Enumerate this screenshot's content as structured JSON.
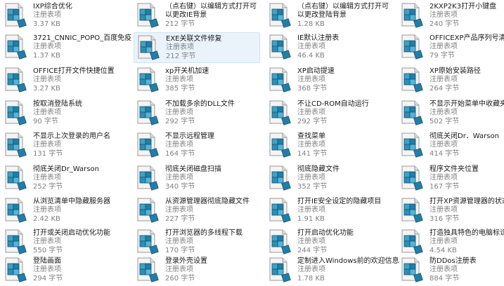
{
  "files": [
    {
      "name": "IXP综合优化",
      "type": "注册表项",
      "size": "3.37 KB",
      "two_line": false,
      "selected": false
    },
    {
      "name": "（点右键）以编辑方式打开可以更改IE背景",
      "type": "注册表项",
      "size": "212 字节",
      "two_line": true,
      "selected": false
    },
    {
      "name": "（点右键）以编辑方式打开可以更改登陆背景",
      "type": "注册表项",
      "size": "1.28 KB",
      "two_line": true,
      "selected": false
    },
    {
      "name": "2KXP2K3打开小键盘",
      "type": "注册表项",
      "size": "240 字节",
      "two_line": false,
      "selected": false
    },
    {
      "name": "3721_CNNIC_POPO_百度免疫",
      "type": "注册表项",
      "size": "1.37 KB",
      "two_line": false,
      "selected": false
    },
    {
      "name": "EXE关联文件修复",
      "type": "注册表项",
      "size": "212 字节",
      "two_line": false,
      "selected": true
    },
    {
      "name": "IE默认注册表",
      "type": "注册表项",
      "size": "46.4 KB",
      "two_line": false,
      "selected": false
    },
    {
      "name": "OFFICEXP产品序列号清除",
      "type": "注册表项",
      "size": "79 字节",
      "two_line": false,
      "selected": false
    },
    {
      "name": "OFFICE打开文件快捷位置",
      "type": "注册表项",
      "size": "3.27 KB",
      "two_line": false,
      "selected": false
    },
    {
      "name": "xp开关机加速",
      "type": "注册表项",
      "size": "385 字节",
      "two_line": false,
      "selected": false
    },
    {
      "name": "XP启动提速",
      "type": "注册表项",
      "size": "368 字节",
      "two_line": false,
      "selected": false
    },
    {
      "name": "XP原始安装路径",
      "type": "注册表项",
      "size": "264 字节",
      "two_line": false,
      "selected": false
    },
    {
      "name": "按取消登陆系统",
      "type": "注册表项",
      "size": "90 字节",
      "two_line": false,
      "selected": false
    },
    {
      "name": "不加载多余的DLL文件",
      "type": "注册表项",
      "size": "292 字节",
      "two_line": false,
      "selected": false
    },
    {
      "name": "不让CD-ROM自动运行",
      "type": "注册表项",
      "size": "292 字节",
      "two_line": false,
      "selected": false
    },
    {
      "name": "不显示开始菜单中收藏夹菜单",
      "type": "注册表项",
      "size": "502 字节",
      "two_line": false,
      "selected": false
    },
    {
      "name": "不显示上次登录的用户名",
      "type": "注册表项",
      "size": "131 字节",
      "two_line": false,
      "selected": false
    },
    {
      "name": "不显示远程管理",
      "type": "注册表项",
      "size": "164 字节",
      "two_line": false,
      "selected": false
    },
    {
      "name": "查找菜单",
      "type": "注册表项",
      "size": "141 字节",
      "two_line": false,
      "selected": false
    },
    {
      "name": "彻底关闭Dr．Warson",
      "type": "注册表项",
      "size": "414 字节",
      "two_line": false,
      "selected": false
    },
    {
      "name": "彻底关闭Dr_Warson",
      "type": "注册表项",
      "size": "252 字节",
      "two_line": false,
      "selected": false
    },
    {
      "name": "彻底关闭磁盘扫描",
      "type": "注册表项",
      "size": "340 字节",
      "two_line": false,
      "selected": false
    },
    {
      "name": "彻底隐藏文件",
      "type": "注册表项",
      "size": "352 字节",
      "two_line": false,
      "selected": false
    },
    {
      "name": "程序文件夹位置",
      "type": "注册表项",
      "size": "167 字节",
      "two_line": false,
      "selected": false
    },
    {
      "name": "从浏览清单中隐藏服务器",
      "type": "注册表项",
      "size": "2.42 KB",
      "two_line": false,
      "selected": false
    },
    {
      "name": "从资源管理器彻底隐藏文件",
      "type": "注册表项",
      "size": "227 字节",
      "two_line": false,
      "selected": false
    },
    {
      "name": "打开IE安全设定的隐藏项目",
      "type": "注册表项",
      "size": "1.91 KB",
      "two_line": false,
      "selected": false
    },
    {
      "name": "打开XP资源管理器的状态栏",
      "type": "注册表项",
      "size": "316 字节",
      "two_line": false,
      "selected": false
    },
    {
      "name": "打开或关闭启动优化功能",
      "type": "注册表项",
      "size": "550 字节",
      "two_line": false,
      "selected": false
    },
    {
      "name": "打开浏览器的多线程下载",
      "type": "注册表项",
      "size": "170 字节",
      "two_line": false,
      "selected": false
    },
    {
      "name": "打开启动优化功能",
      "type": "注册表项",
      "size": "244 字节",
      "two_line": false,
      "selected": false
    },
    {
      "name": "打造独具特色的电脑标识",
      "type": "注册表项",
      "size": "4.54 KB",
      "two_line": false,
      "selected": false
    },
    {
      "name": "登陆画面",
      "type": "注册表项",
      "size": "294 字节",
      "two_line": false,
      "selected": false
    },
    {
      "name": "登录外壳设置",
      "type": "注册表项",
      "size": "260 字节",
      "two_line": false,
      "selected": false
    },
    {
      "name": "定制进入Windows前的欢迎信息",
      "type": "注册表项",
      "size": "1.78 KB",
      "two_line": false,
      "selected": false
    },
    {
      "name": "防DDos注册表",
      "type": "注册表项",
      "size": "884 字节",
      "two_line": false,
      "selected": false
    }
  ],
  "icon": "registry-file-icon"
}
